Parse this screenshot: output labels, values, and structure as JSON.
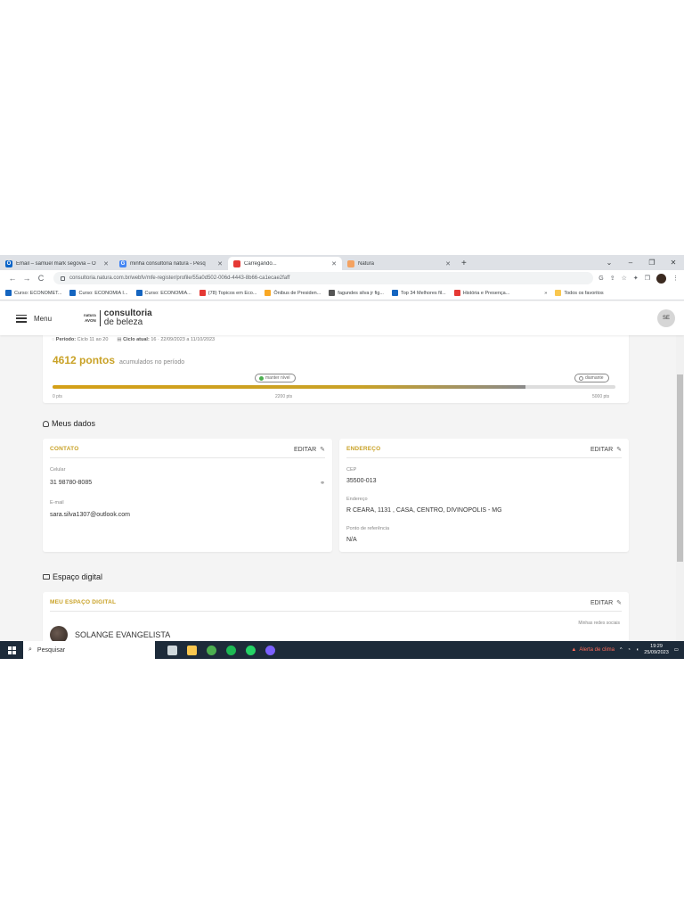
{
  "browser": {
    "tabs": [
      {
        "label": "Email – samuel mark segovia – O",
        "favicon_color": "#0a64c8",
        "favicon_glyph": "O",
        "active": false
      },
      {
        "label": "minha consultoria natura - Pesq",
        "favicon_color": "#4285f4",
        "favicon_glyph": "G",
        "active": false
      },
      {
        "label": "Carregando...",
        "favicon_color": "#e53935",
        "favicon_glyph": "",
        "active": true
      },
      {
        "label": "Natura",
        "favicon_color": "#f4a261",
        "favicon_glyph": "",
        "active": false
      }
    ],
    "new_tab": "+",
    "window_controls": {
      "dropdown": "⌄",
      "minimize": "–",
      "restore": "❐",
      "close": "✕"
    },
    "url": "consultoria.natura.com.br/webfv/mfe-register/profile/55a0d502-006d-4443-8b66-ca1ecae2faff",
    "nav": {
      "back": "←",
      "forward": "→",
      "reload": "C"
    },
    "addr_icons": {
      "google": "G",
      "share": "⇪",
      "star": "☆",
      "extensions": "✦",
      "sidebar": "❒",
      "menu": "⋮"
    },
    "bookmarks": [
      {
        "label": "Curso: ECONOMET...",
        "color": "#1565c0"
      },
      {
        "label": "Curso: ECONOMIA I...",
        "color": "#1565c0"
      },
      {
        "label": "Curso: ECONOMIA...",
        "color": "#1565c0"
      },
      {
        "label": "(78) Topicos em Eco...",
        "color": "#e53935"
      },
      {
        "label": "Ônibus de Presiden...",
        "color": "#f9a825"
      },
      {
        "label": "fagundes silva jr fig...",
        "color": "#555555"
      },
      {
        "label": "Top 34 Melhores fil...",
        "color": "#1565c0"
      },
      {
        "label": "História e Presença...",
        "color": "#e53935"
      }
    ],
    "bookmarks_more": "»",
    "all_bookmarks": "Todos os favoritos"
  },
  "header": {
    "menu_label": "Menu",
    "logo_brand_top": "natura",
    "logo_brand_bottom": "AVON",
    "logo_line1": "consultoria",
    "logo_line2": "de beleza",
    "avatar_initials": "SE"
  },
  "points": {
    "period_label": "Período:",
    "period_value": "Ciclo 11 ao 20",
    "cycle_label": "Ciclo atual:",
    "cycle_value": "16 · 22/09/2023 a 11/10/2023",
    "value": "4612 pontos",
    "value_sub": "acumulados no período",
    "progress_fraction": 0.84,
    "badge_keep": "manter nível",
    "badge_diamond": "diamante",
    "scale_min": "0 pts",
    "scale_mid": "2200 pts",
    "scale_max": "5000 pts"
  },
  "meus_dados": {
    "title": "Meus dados",
    "contato": {
      "title": "CONTATO",
      "edit": "EDITAR",
      "phone_label": "Celular",
      "phone_value": "31 98780-8085",
      "email_label": "E-mail",
      "email_value": "sara.silva1307@outlook.com"
    },
    "endereco": {
      "title": "ENDEREÇO",
      "edit": "EDITAR",
      "cep_label": "CEP",
      "cep_value": "35500-013",
      "address_label": "Endereço",
      "address_value": "R CEARA, 1131 , CASA, CENTRO, DIVINOPOLIS - MG",
      "ref_label": "Ponto de referência",
      "ref_value": "N/A"
    }
  },
  "espaco_digital": {
    "title": "Espaço digital",
    "card_title": "MEU ESPAÇO DIGITAL",
    "edit": "EDITAR",
    "social_label": "Minhas redes sociais",
    "person_name": "SOLANGE EVANGELISTA"
  },
  "taskbar": {
    "search_placeholder": "Pesquisar",
    "weather": "Alerta de clima",
    "time": "19:29",
    "date": "25/09/2023",
    "icons": [
      {
        "name": "task-view",
        "color": "#cfd8dc"
      },
      {
        "name": "file-explorer",
        "color": "#f9c74f"
      },
      {
        "name": "chrome",
        "color": "#4caf50"
      },
      {
        "name": "spotify",
        "color": "#1db954"
      },
      {
        "name": "whatsapp",
        "color": "#25d366"
      },
      {
        "name": "messenger",
        "color": "#7b61ff"
      }
    ]
  }
}
